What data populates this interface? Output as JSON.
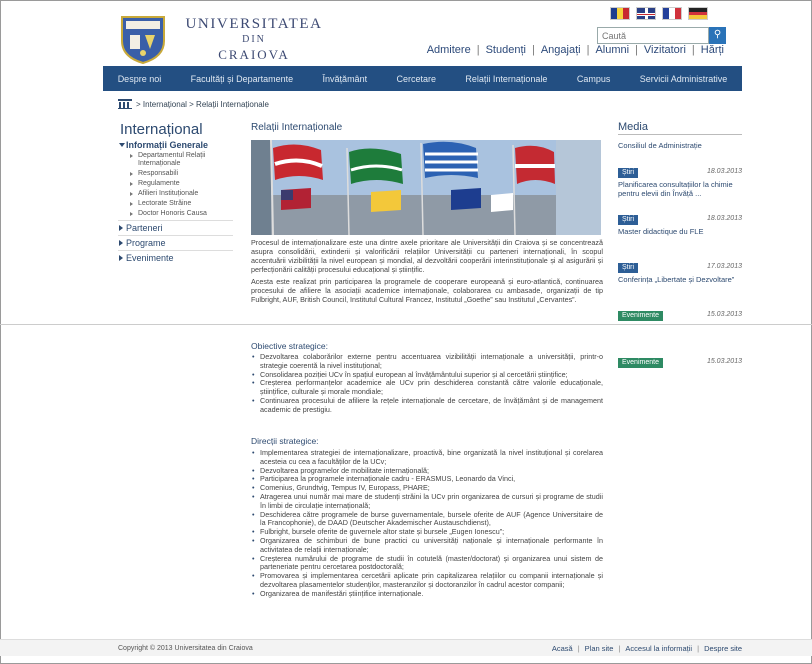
{
  "university": {
    "line1": "UNIVERSITATEA",
    "line2": "DIN",
    "line3": "CRAIOVA"
  },
  "search": {
    "placeholder": "Caută",
    "button_icon": "search-icon"
  },
  "top_nav": [
    "Admitere",
    "Studenți",
    "Angajați",
    "Alumni",
    "Vizitatori",
    "Hărți"
  ],
  "main_nav": [
    "Despre noi",
    "Facultăți și Departamente",
    "Învățământ",
    "Cercetare",
    "Relații Internaționale",
    "Campus",
    "Servicii Administrative"
  ],
  "breadcrumb": {
    "home_icon": "home-icon",
    "items": "> Internațional > Relații Internaționale"
  },
  "sidebar": {
    "title": "Internațional",
    "group_open": "Informații Generale",
    "items": [
      "Departamentul Relații Internaționale",
      "Responsabili",
      "Regulamente",
      "Afilieri Instituționale",
      "Lectorate Străine",
      "Doctor Honoris Causa"
    ],
    "groups": [
      "Parteneri",
      "Programe",
      "Evenimente"
    ]
  },
  "main": {
    "title": "Relații Internaționale",
    "intro": [
      "Procesul de internaționalizare este una dintre axele prioritare ale Universității din Craiova și se concentrează asupra consolidării, extinderii și valorificării relațiilor Universității cu parteneri internaționali, în scopul accentuării vizibilității la nivel european și mondial, al dezvoltării cooperării interinstituționale și al asigurării și perfecționării calității procesului educațional și științific.",
      "Acesta este realizat prin participarea la programele de cooperare europeană și euro-atlantică, continuarea procesului de afiliere la asociații academice internaționale, colaborarea cu ambasade, organizații de tip Fulbright, AUF, British Council, Institutul Cultural Francez, Institutul „Goethe” sau Institutul „Cervantes”."
    ],
    "objectives_title": "Obiective strategice:",
    "objectives": [
      "Dezvoltarea colaborărilor externe pentru accentuarea vizibilității internaționale a universității, printr-o strategie coerentă la nivel instituțional;",
      "Consolidarea poziției UCv în spațiul european al învățământului superior și al cercetării științifice;",
      "Creșterea performanțelor academice ale UCv prin deschiderea constantă către valorile educaționale, științifice, culturale și morale mondiale;",
      "Continuarea procesului de afiliere la rețele internaționale de cercetare, de învățământ și de management academic de prestigiu."
    ],
    "directions_title": "Direcții strategice:",
    "directions": [
      "Implementarea strategiei de internaționalizare, proactivă, bine organizată la nivel instituțional și corelarea acesteia cu cea a facultăților de la UCv;",
      "Dezvoltarea programelor de mobilitate internațională;",
      "Participarea la programele internaționale cadru - ERASMUS, Leonardo da Vinci,",
      "Comenius, Grundtvig, Tempus IV, Europass, PHARE;",
      "Atragerea unui număr mai mare de studenți străini la UCv prin organizarea de cursuri și programe de studii în limbi de circulație internațională;",
      "Deschiderea către programele de burse guvernamentale, bursele oferite de AUF (Agence Universitaire de la Francophonie), de DAAD (Deutscher Akademischer Austauschdienst),",
      "Fulbright, bursele oferite de guvernele altor state și bursele „Eugen Ionescu”;",
      "Organizarea de schimburi de bune practici cu universități naționale și internaționale performante în activitatea de relații internaționale;",
      "Creșterea numărului de programe de studii în cotutelă (master/doctorat) și organizarea unui sistem de parteneriate pentru cercetarea postdoctorală;",
      "Promovarea și implementarea cercetării aplicate prin capitalizarea relațiilor cu companii internaționale și dezvoltarea plasamentelor studenților, masteranzilor și doctoranzilor în cadrul acestor companii;",
      "Organizarea de manifestări științifice internaționale."
    ]
  },
  "media": {
    "title": "Media",
    "news": [
      {
        "badge": "",
        "date": "",
        "title": "Consiliul de Administrație"
      },
      {
        "badge": "Știri",
        "date": "18.03.2013",
        "title": "Planificarea consultațiilor la chimie pentru elevii din Învăță ..."
      },
      {
        "badge": "Știri",
        "date": "18.03.2013",
        "title": "Master didactique du FLE"
      },
      {
        "badge": "Știri",
        "date": "17.03.2013",
        "title": "Conferința „Libertate și Dezvoltare”"
      },
      {
        "badge": "Evenimente",
        "date": "15.03.2013",
        "title": ""
      },
      {
        "badge": "Evenimente",
        "date": "15.03.2013",
        "title": ""
      }
    ]
  },
  "footer": {
    "copyright": "Copyright © 2013 Universitatea din Craiova",
    "links": [
      "Acasă",
      "Plan site",
      "Accesul la informații",
      "Despre site"
    ]
  },
  "colors": {
    "nav_bg": "#234f82",
    "accent": "#2d4a70",
    "badge_news": "#2d5e96",
    "badge_events": "#2e8a63"
  }
}
